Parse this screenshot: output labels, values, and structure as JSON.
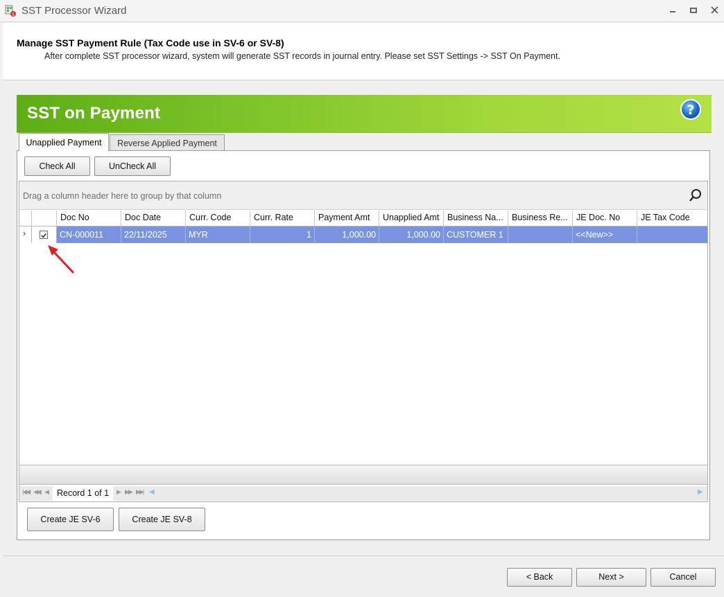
{
  "window": {
    "title": "SST Processor Wizard",
    "minimize_glyph": "▬",
    "maximize_glyph": "■",
    "close_glyph": "✕"
  },
  "header": {
    "title": "Manage SST Payment Rule (Tax Code use in SV-6 or SV-8)",
    "subtitle": "After complete SST processor wizard, system will generate SST records in journal entry. Please set SST Settings -> SST On Payment."
  },
  "banner": {
    "title": "SST on Payment",
    "help_icon": "help-icon"
  },
  "tabs": [
    {
      "label": "Unapplied Payment",
      "active": true
    },
    {
      "label": "Reverse Applied Payment",
      "active": false
    }
  ],
  "toolbar": {
    "check_all": "Check All",
    "uncheck_all": "UnCheck All"
  },
  "grid": {
    "group_hint": "Drag a column header here to group by that column",
    "columns": [
      "Doc No",
      "Doc Date",
      "Curr. Code",
      "Curr. Rate",
      "Payment Amt",
      "Unapplied Amt",
      "Business Na...",
      "Business Re...",
      "JE Doc. No",
      "JE Tax Code"
    ],
    "rows": [
      {
        "indicator": "›",
        "checked": true,
        "doc_no": "CN-000011",
        "doc_date": "22/11/2025",
        "curr_code": "MYR",
        "curr_rate": "1",
        "payment_amt": "1,000.00",
        "unapplied_amt": "1,000.00",
        "business_name": "CUSTOMER 1",
        "business_reg": "",
        "je_doc_no": "<<New>>",
        "je_tax_code": ""
      }
    ],
    "navigator": {
      "record_text": "Record 1 of 1"
    }
  },
  "actions": {
    "create_sv6": "Create JE SV-6",
    "create_sv8": "Create JE SV-8"
  },
  "wizard": {
    "back": "< Back",
    "next": "Next >",
    "cancel": "Cancel"
  },
  "colors": {
    "banner_green": "#7fc52a",
    "selection_blue": "#7a93e0",
    "arrow_red": "#e02020"
  }
}
